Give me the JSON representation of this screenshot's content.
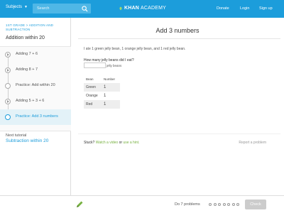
{
  "header": {
    "subjects_label": "Subjects",
    "search_placeholder": "Search",
    "logo_bold": "KHAN",
    "logo_light": "ACADEMY",
    "donate": "Donate",
    "login": "Login",
    "signup": "Sign up"
  },
  "sidebar": {
    "breadcrumb": "1st grade > Addition and subtraction",
    "unit_title": "Addition within 20",
    "items": [
      {
        "label": "Adding 7 + 6",
        "icon": "play-icon"
      },
      {
        "label": "Adding 8 + 7",
        "icon": "play-icon"
      },
      {
        "label": "Practice: Add within 20",
        "icon": "practice-icon"
      },
      {
        "label": "Adding 5 + 3 + 6",
        "icon": "play-icon"
      },
      {
        "label": "Practice: Add 3 numbers",
        "icon": "practice-icon",
        "active": true
      }
    ],
    "next_label": "Next tutorial",
    "next_link": "Subtraction within 20"
  },
  "exercise": {
    "title": "Add 3 numbers",
    "statement": "I ate 1 green jelly bean, 1 orange jelly bean, and 1 red jelly bean.",
    "question": "How many jelly beans did I eat?",
    "answer_value": "",
    "answer_unit": "jelly beans",
    "table": {
      "headers": [
        "Bean",
        "Number"
      ],
      "rows": [
        [
          "Green",
          "1"
        ],
        [
          "Orange",
          "1"
        ],
        [
          "Red",
          "1"
        ]
      ]
    },
    "stuck_prefix": "Stuck?",
    "stuck_link_video": "Watch a video",
    "stuck_or": "or",
    "stuck_link_hint": "use a hint.",
    "report": "Report a problem"
  },
  "footer": {
    "progress": "Do 7 problems",
    "total_dots": 7,
    "check": "Check"
  },
  "colors": {
    "brand": "#1c9ddb",
    "hint_green": "#77b140",
    "check_disabled": "#cccccc"
  }
}
